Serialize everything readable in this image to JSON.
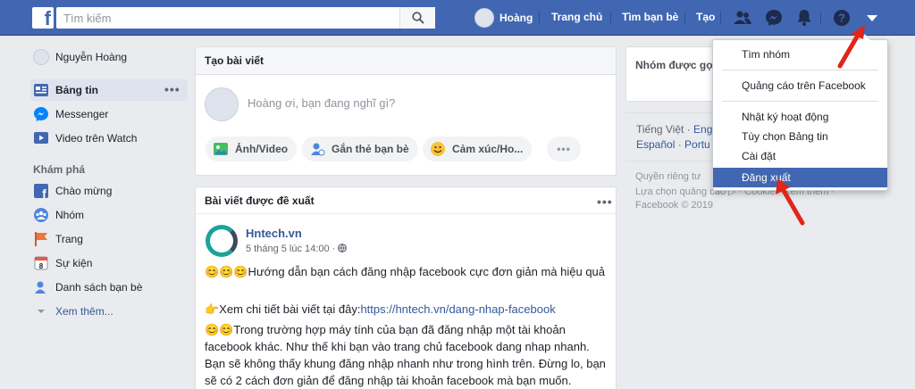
{
  "colors": {
    "brand": "#4267b2",
    "link": "#365899",
    "bg": "#e9ebee",
    "arrow": "#e0251b"
  },
  "topbar": {
    "logo": "f",
    "search_placeholder": "Tìm kiếm",
    "user_name": "Hoàng",
    "nav": [
      "Trang chủ",
      "Tìm bạn bè",
      "Tạo"
    ]
  },
  "sidebar": {
    "profile_name": "Nguyễn Hoàng",
    "items": [
      {
        "label": "Bảng tin",
        "icon": "news-feed-icon"
      },
      {
        "label": "Messenger",
        "icon": "messenger-icon"
      },
      {
        "label": "Video trên Watch",
        "icon": "watch-icon"
      }
    ],
    "explore_title": "Khám phá",
    "explore_items": [
      {
        "label": "Chào mừng",
        "icon": "facebook-icon"
      },
      {
        "label": "Nhóm",
        "icon": "groups-icon"
      },
      {
        "label": "Trang",
        "icon": "flag-icon"
      },
      {
        "label": "Sự kiện",
        "icon": "calendar-icon"
      },
      {
        "label": "Danh sách bạn bè",
        "icon": "friends-list-icon"
      }
    ],
    "see_more": "Xem thêm..."
  },
  "composer": {
    "title": "Tạo bài viết",
    "placeholder": "Hoàng ơi, bạn đang nghĩ gì?",
    "actions": [
      "Ảnh/Video",
      "Gắn thẻ bạn bè",
      "Cảm xúc/Ho..."
    ],
    "more": "•••"
  },
  "post": {
    "section_title": "Bài viết được đề xuất",
    "author": "Hntech.vn",
    "time": "5 tháng 5 lúc 14:00 · ",
    "line1": "😊😊😊Hướng dẫn bạn cách đăng nhập facebook cực đơn giản mà hiệu quả",
    "line2_prefix": "👉Xem chi tiết bài viết tại đây:",
    "line2_link": "https://hntech.vn/dang-nhap-facebook",
    "line3": "😊😊Trong trường hợp máy tính của bạn đã đăng nhập một tài khoản facebook khác. Như thế khi bạn vào trang chủ facebook dang nhap nhanh. Bạn sẽ không thấy khung đăng nhập nhanh như trong hình trên. Đừng lo, bạn sẽ có 2 cách đơn giản để đăng nhập tài khoản facebook mà bạn muốn."
  },
  "right": {
    "groups_title": "Nhóm được gợ",
    "langs_row1": [
      "Tiếng Việt",
      "Eng"
    ],
    "langs_row2": [
      "Español",
      "Portu"
    ],
    "footer1": "Quyền riêng tư",
    "footer2": "Lựa chọn quảng cáo ▷ · Cookie · Xem thêm ·",
    "footer3": "Facebook © 2019"
  },
  "dropdown": {
    "items": [
      "Tìm nhóm",
      "Quảng cáo trên Facebook",
      "Nhật ký hoạt động",
      "Tùy chọn Bảng tin",
      "Cài đặt",
      "Đăng xuất"
    ],
    "active_index": 5
  }
}
